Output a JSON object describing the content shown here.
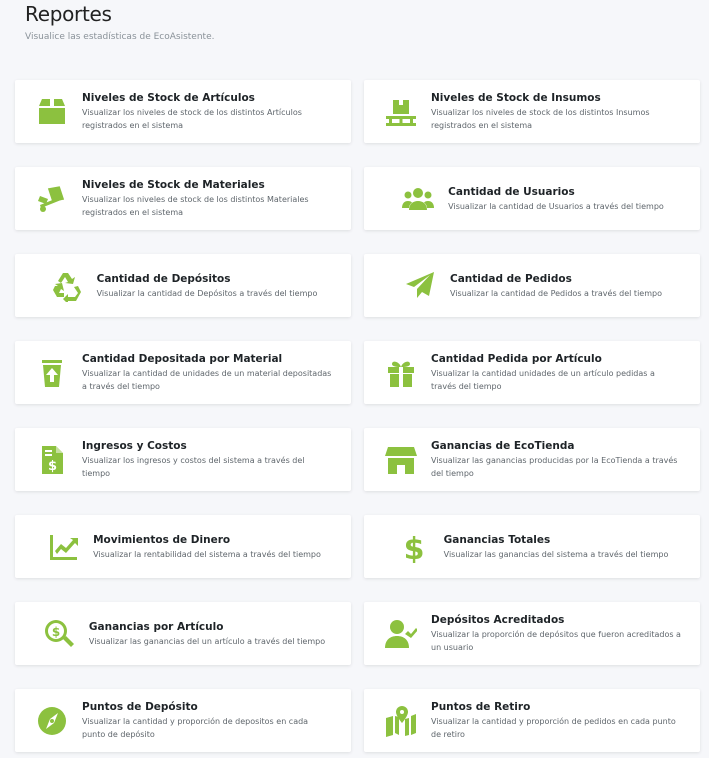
{
  "header": {
    "title": "Reportes",
    "subtitle": "Visualice las estadísticas de EcoAsistente."
  },
  "accent": "#8cc13f",
  "cards": [
    {
      "icon": "box-icon",
      "title": "Niveles de Stock de Artículos",
      "desc": "Visualizar los niveles de stock de los distintos Artículos registrados en el sistema"
    },
    {
      "icon": "pallet-box-icon",
      "title": "Niveles de Stock de Insumos",
      "desc": "Visualizar los niveles de stock de los distintos Insumos registrados en el sistema"
    },
    {
      "icon": "dolly-icon",
      "title": "Niveles de Stock de Materiales",
      "desc": "Visualizar los niveles de stock de los distintos Materiales registrados en el sistema"
    },
    {
      "icon": "users-icon",
      "title": "Cantidad de Usuarios",
      "desc": "Visualizar la cantidad de Usuarios a través del tiempo"
    },
    {
      "icon": "recycle-icon",
      "title": "Cantidad de Depósitos",
      "desc": "Visualizar la cantidad de Depósitos a través del tiempo"
    },
    {
      "icon": "paper-plane-icon",
      "title": "Cantidad de Pedidos",
      "desc": "Visualizar la cantidad de Pedidos a través del tiempo"
    },
    {
      "icon": "trash-upload-icon",
      "title": "Cantidad Depositada por Material",
      "desc": "Visualizar la cantidad de unidades de un material depositadas a través del tiempo"
    },
    {
      "icon": "gift-icon",
      "title": "Cantidad Pedida por Artículo",
      "desc": "Visualizar la cantidad unidades de un artículo pedidas a través del tiempo"
    },
    {
      "icon": "invoice-dollar-icon",
      "title": "Ingresos y Costos",
      "desc": "Visualizar los ingresos y costos del sistema a través del tiempo"
    },
    {
      "icon": "store-icon",
      "title": "Ganancias de EcoTienda",
      "desc": "Visualizar las ganancias producidas por la EcoTienda a través del tiempo"
    },
    {
      "icon": "chart-line-icon",
      "title": "Movimientos de Dinero",
      "desc": "Visualizar la rentabilidad del sistema a través del tiempo"
    },
    {
      "icon": "dollar-sign-icon",
      "title": "Ganancias Totales",
      "desc": "Visualizar las ganancias del sistema a través del tiempo"
    },
    {
      "icon": "search-dollar-icon",
      "title": "Ganancias por Artículo",
      "desc": "Visualizar las ganancias del un artículo a través del tiempo"
    },
    {
      "icon": "user-check-icon",
      "title": "Depósitos Acreditados",
      "desc": "Visualizar la proporción de depósitos que fueron acreditados a un usuario"
    },
    {
      "icon": "compass-icon",
      "title": "Puntos de Depósito",
      "desc": "Visualizar la cantidad y proporción de depositos en cada punto de depósito"
    },
    {
      "icon": "map-marked-icon",
      "title": "Puntos de Retiro",
      "desc": "Visualizar la cantidad y proporción de pedidos en cada punto de retiro"
    }
  ]
}
